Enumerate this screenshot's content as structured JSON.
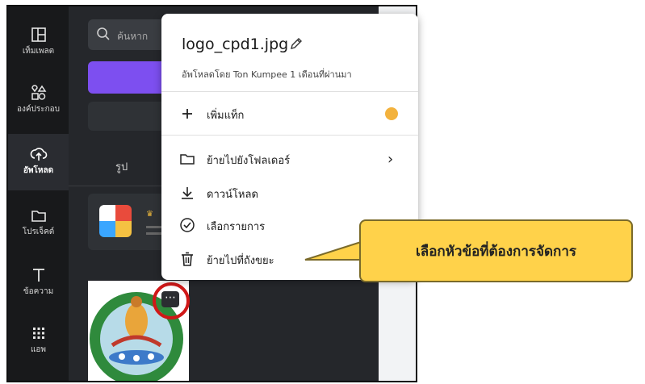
{
  "rail": {
    "items": [
      {
        "label": "เท็มเพลต",
        "icon": "template-icon"
      },
      {
        "label": "องค์ประกอบ",
        "icon": "elements-icon"
      },
      {
        "label": "อัพโหลด",
        "icon": "upload-icon"
      },
      {
        "label": "โปรเจ็คต์",
        "icon": "folder-icon"
      },
      {
        "label": "ข้อความ",
        "icon": "text-icon"
      },
      {
        "label": "แอพ",
        "icon": "apps-icon"
      }
    ]
  },
  "panel": {
    "search_placeholder": "ค้นหาก",
    "tab_label": "รูป"
  },
  "menu": {
    "filename": "logo_cpd1.jpg",
    "subtitle": "อัพโหลดโดย Ton Kumpee 1 เดือนที่ผ่านมา",
    "items": [
      {
        "label": "เพิ่มแท็ก",
        "icon": "plus-icon"
      },
      {
        "label": "ย้ายไปยังโฟลเดอร์",
        "icon": "folder-icon"
      },
      {
        "label": "ดาวน์โหลด",
        "icon": "download-icon"
      },
      {
        "label": "เลือกรายการ",
        "icon": "check-circle-icon"
      },
      {
        "label": "ย้ายไปที่ถังขยะ",
        "icon": "trash-icon"
      }
    ]
  },
  "callout": {
    "text": "เลือกหัวข้อที่ต้องการจัดการ"
  },
  "colors": {
    "accent_purple": "#7d4ff0",
    "callout_yellow": "#ffd24a",
    "highlight_red": "#d01818"
  }
}
